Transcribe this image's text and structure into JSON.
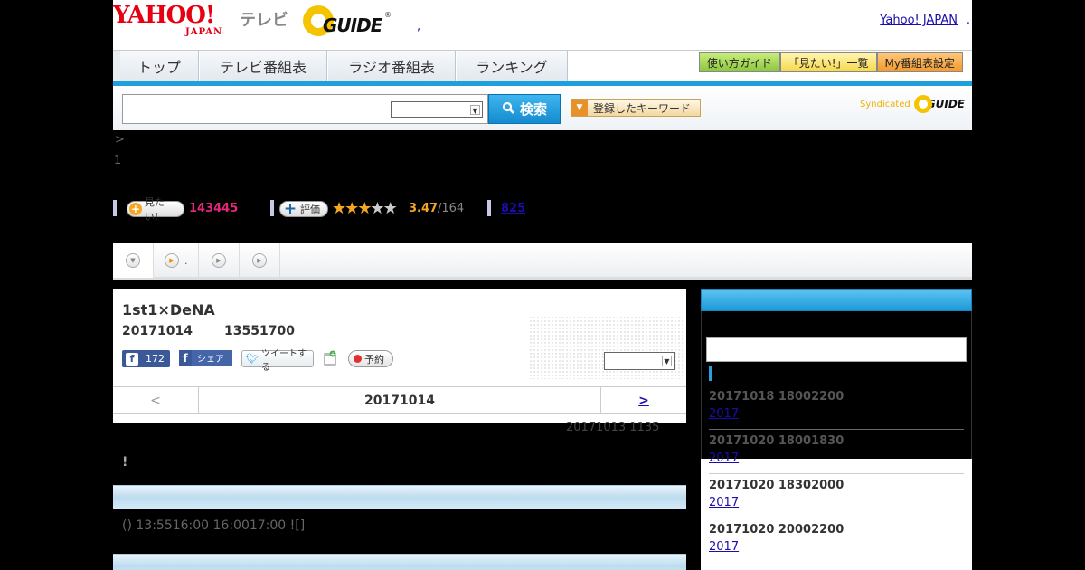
{
  "header": {
    "yahoo_logo_big": "YAHOO!",
    "yahoo_logo_small": "JAPAN",
    "tv_label": "テレビ",
    "gguide_logo": "GUIDE",
    "gguide_reg": "®",
    "yahoo_japan_link": "Yahoo! JAPAN",
    "dot_a": ".",
    "dot_b": ","
  },
  "nav": {
    "tabs": [
      "トップ",
      "テレビ番組表",
      "ラジオ番組表",
      "ランキング"
    ],
    "sub": [
      "使い方ガイド",
      "「見たい!」一覧",
      "My番組表設定"
    ]
  },
  "search": {
    "button_label": "検索",
    "keyword_button": "登録したキーワード",
    "syndicated_label": "Syndicated",
    "syndicated_logo": "GUIDE"
  },
  "breadcrumb": {
    "arrow": ">",
    "number": "1"
  },
  "stats": {
    "mitai_label": "見たい!",
    "mitai_count": "143445",
    "rate_label": "評価",
    "rating_stars": 3,
    "rating": "3.47",
    "rating_count": "/164",
    "link_count": "825"
  },
  "tabs": {
    "tab2_suffix": "."
  },
  "program": {
    "title": "1st1×DeNA",
    "date": "20171014",
    "time": "13551700",
    "fb_like_count": "172",
    "fb_share_label": "シェア",
    "tweet_label": "ツイートする",
    "reserve_label": "予約",
    "pager_prev": "<",
    "pager_date": "20171014",
    "pager_next": ">"
  },
  "update_stamp": "20171013  1135",
  "exclamation": "!",
  "broadcast_info": "() 13:5516:00  16:0017:00 ![]",
  "sidebar": {
    "items": [
      {
        "when": "20171018  18002200",
        "year": "2017"
      },
      {
        "when": "20171020  18001830",
        "year": "2017"
      },
      {
        "when": "20171020  18302000",
        "year": "2017"
      },
      {
        "when": "20171020  20002200",
        "year": "2017"
      }
    ]
  }
}
